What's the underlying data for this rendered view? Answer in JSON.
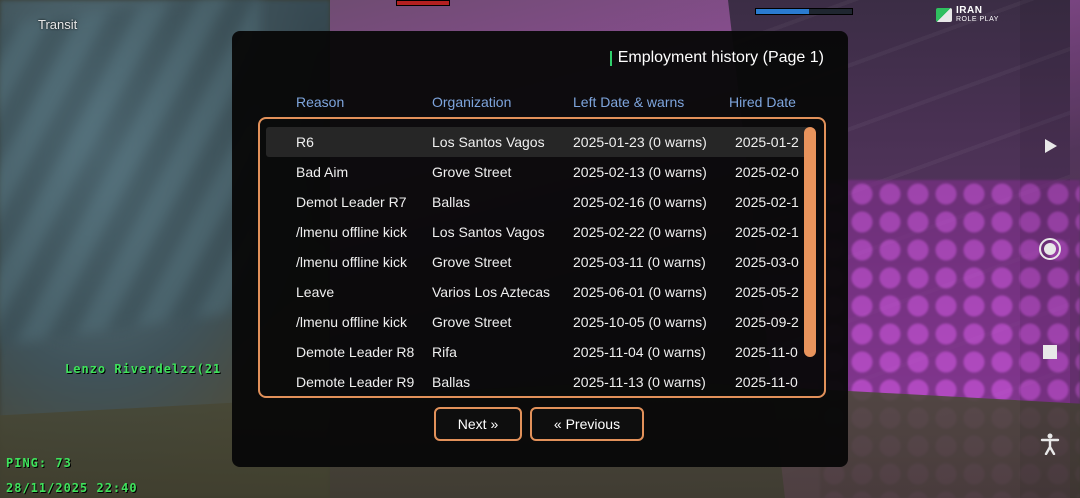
{
  "hud": {
    "location": "Transit",
    "player_name": "Lenzo Riverdelzz(21",
    "ping": "PING: 73",
    "datetime": "28/11/2025 22:40",
    "logo_line1": "IRAN",
    "logo_line2": "ROLE PLAY",
    "armor_level": 0.55
  },
  "dialog": {
    "title": "Employment history (Page 1)",
    "columns": [
      "Reason",
      "Organization",
      "Left Date & warns",
      "Hired Date"
    ],
    "rows": [
      {
        "reason": "R6",
        "organization": "Los Santos Vagos",
        "left": "2025-01-23 (0 warns)",
        "hired": "2025-01-2"
      },
      {
        "reason": "Bad Aim",
        "organization": "Grove Street",
        "left": "2025-02-13 (0 warns)",
        "hired": "2025-02-0"
      },
      {
        "reason": "Demot Leader R7",
        "organization": "Ballas",
        "left": "2025-02-16 (0 warns)",
        "hired": "2025-02-1"
      },
      {
        "reason": "/lmenu offline kick",
        "organization": "Los Santos Vagos",
        "left": "2025-02-22 (0 warns)",
        "hired": "2025-02-1"
      },
      {
        "reason": "/lmenu offline kick",
        "organization": "Grove Street",
        "left": "2025-03-11 (0 warns)",
        "hired": "2025-03-0"
      },
      {
        "reason": "Leave",
        "organization": "Varios Los Aztecas",
        "left": "2025-06-01 (0 warns)",
        "hired": "2025-05-2"
      },
      {
        "reason": "/lmenu offline kick",
        "organization": "Grove Street",
        "left": "2025-10-05 (0 warns)",
        "hired": "2025-09-2"
      },
      {
        "reason": "Demote Leader R8",
        "organization": "Rifa",
        "left": "2025-11-04 (0 warns)",
        "hired": "2025-11-0"
      },
      {
        "reason": "Demote Leader R9",
        "organization": "Ballas",
        "left": "2025-11-13 (0 warns)",
        "hired": "2025-11-0"
      }
    ],
    "next_label": "Next »",
    "prev_label": "« Previous"
  },
  "colors": {
    "accent": "#e2915a",
    "header_text": "#7ea5dd",
    "hud_green": "#3fe35c",
    "title_bar": "#2fcf6b"
  },
  "icons": {
    "side_buttons": [
      "play-icon",
      "record-icon",
      "stop-icon",
      "accessibility-icon"
    ]
  }
}
